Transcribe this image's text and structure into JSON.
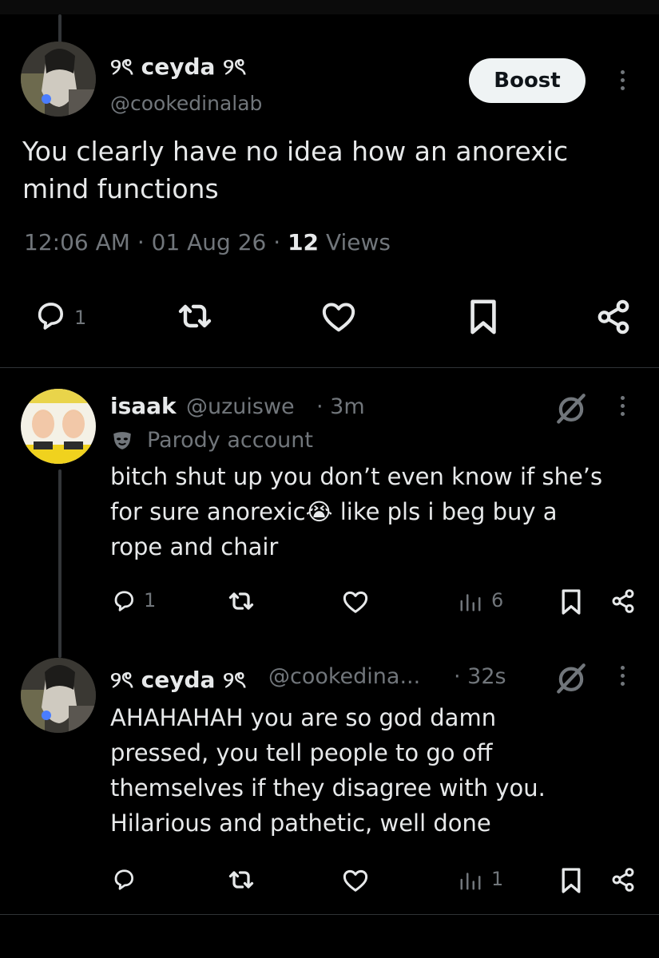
{
  "main_post": {
    "author_name": "୨ৎ ceyda ୨ৎ",
    "handle": "@cookedinalab",
    "boost_label": "Boost",
    "text_lines": [
      "You clearly have no idea how an anorexic",
      "mind functions"
    ],
    "time": "12:06 AM",
    "date": "01 Aug 26",
    "views_count": "12",
    "views_label": "Views",
    "reply_count": "1"
  },
  "reply_1": {
    "author_name": "isaak",
    "handle": "@uzuiswe",
    "age": "3m",
    "badge_label": "Parody account",
    "text_lines": [
      "bitch shut up you don’t even know if she’s",
      "for sure anorexic😭 like pls i beg buy a",
      "rope and chair"
    ],
    "reply_count": "1",
    "views_count": "6"
  },
  "reply_2": {
    "author_name": "୨ৎ ceyda ୨ৎ",
    "handle": "@cookedina...",
    "age": "32s",
    "text_lines": [
      "AHAHAHAH you are so god damn",
      "pressed, you tell people to go off",
      "themselves if they disagree with you.",
      "Hilarious and pathetic, well done"
    ],
    "views_count": "1"
  },
  "icons": [
    "reply-icon",
    "repost-icon",
    "like-icon",
    "bookmark-icon",
    "share-icon",
    "views-icon",
    "grok-icon",
    "more-icon",
    "mask-icon"
  ],
  "colors": {
    "background": "#000000",
    "text": "#e7e9ea",
    "muted": "#71767b",
    "divider": "#2f3336",
    "button": "#eff3f4"
  }
}
